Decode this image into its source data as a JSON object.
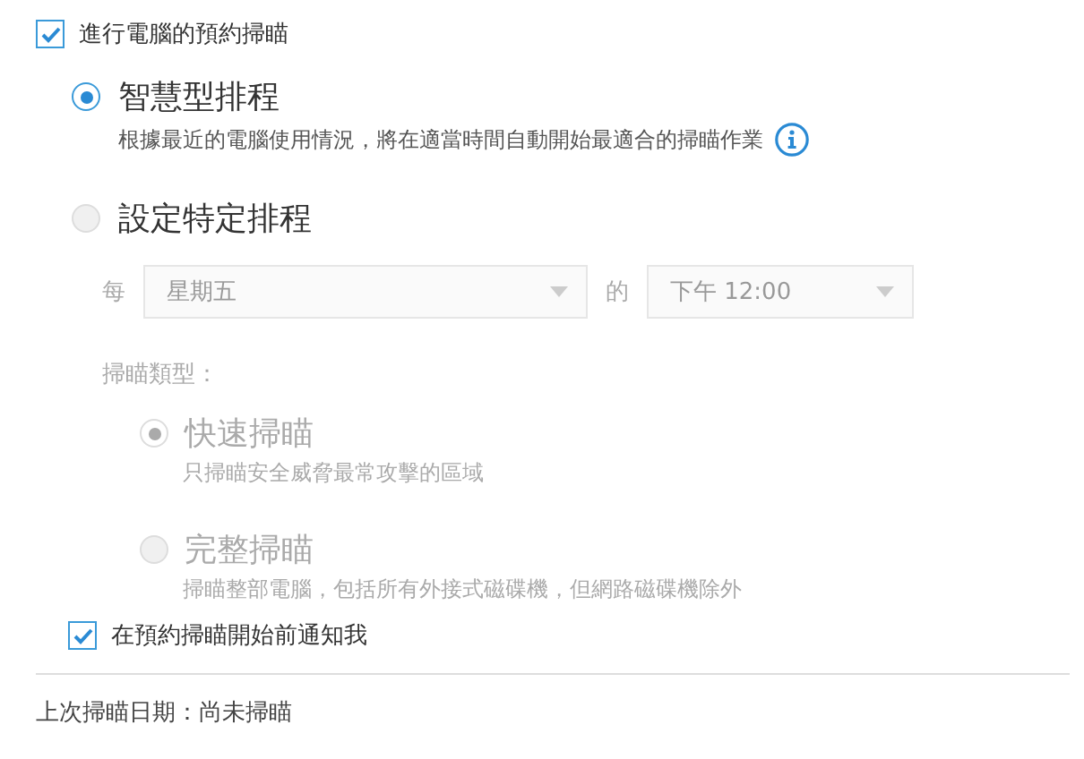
{
  "scheduled_scan": {
    "label": "進行電腦的預約掃瞄",
    "checked": true
  },
  "schedule_options": [
    {
      "label": "智慧型排程",
      "description": "根據最近的電腦使用情況，將在適當時間自動開始最適合的掃瞄作業",
      "selected": true,
      "has_info": true
    },
    {
      "label": "設定特定排程",
      "selected": false,
      "has_info": false
    }
  ],
  "frequency": {
    "prefix": "每",
    "day": "星期五",
    "joiner": "的",
    "time": "下午 12:00",
    "disabled": true
  },
  "scan_type": {
    "label": "掃瞄類型：",
    "disabled": true,
    "options": [
      {
        "label": "快速掃瞄",
        "description": "只掃瞄安全威脅最常攻擊的區域",
        "selected": true
      },
      {
        "label": "完整掃瞄",
        "description": "掃瞄整部電腦，包括所有外接式磁碟機，但網路磁碟機除外",
        "selected": false
      }
    ]
  },
  "notify": {
    "label": "在預約掃瞄開始前通知我",
    "checked": true
  },
  "last_scan": "上次掃瞄日期：尚未掃瞄"
}
